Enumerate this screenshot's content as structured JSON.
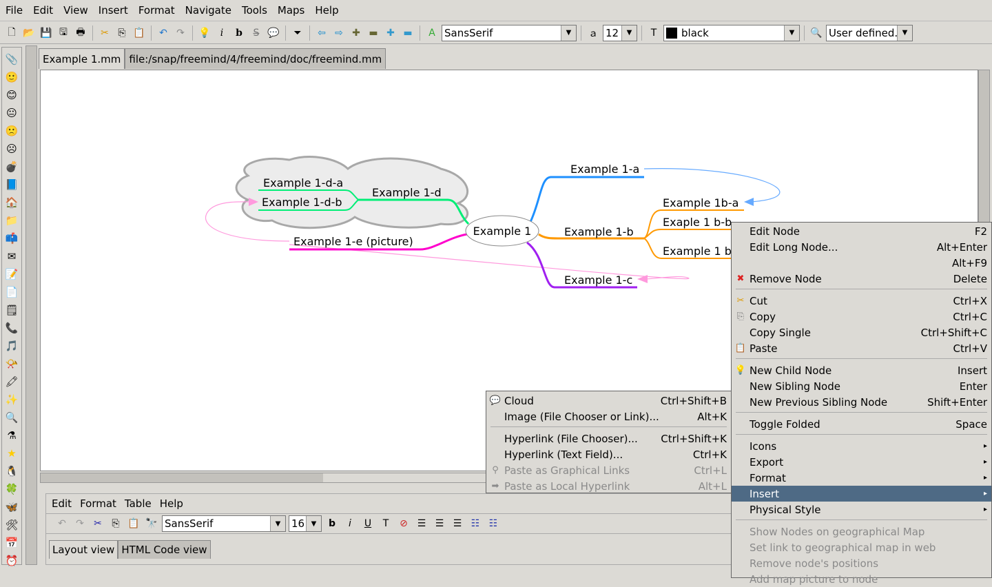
{
  "menubar": {
    "items": [
      "File",
      "Edit",
      "View",
      "Insert",
      "Format",
      "Navigate",
      "Tools",
      "Maps",
      "Help"
    ]
  },
  "toolbar": {
    "font": "SansSerif",
    "size": "12",
    "color_name": "black",
    "color": "#000000",
    "style": "User defined."
  },
  "tabs": [
    {
      "label": "Example 1.mm",
      "active": true
    },
    {
      "label": "file:/snap/freemind/4/freemind/doc/freemind.mm",
      "active": false
    }
  ],
  "mindmap": {
    "root": "Example 1",
    "nodes": {
      "a": "Example 1-a",
      "b": "Example 1-b",
      "ba": "Example 1b-a",
      "bb": "Exaple 1 b-b",
      "bc": "Example 1 b",
      "c": "Example 1-c",
      "d": "Example 1-d",
      "da": "Example 1-d-a",
      "db": "Example 1-d-b",
      "e": "Example 1-e (picture)"
    },
    "colors": {
      "a": "#1e90ff",
      "b": "#ff9900",
      "c": "#a020f0",
      "d": "#00ee76",
      "e": "#ff00cc",
      "link_blue": "#66aaff",
      "link_pink": "#ff99dd"
    }
  },
  "context_menu": {
    "items": [
      {
        "label": "Edit Node",
        "shortcut": "F2",
        "icon": ""
      },
      {
        "label": "Edit Long Node...",
        "shortcut": "Alt+Enter",
        "icon": ""
      },
      {
        "label": "",
        "shortcut": "Alt+F9",
        "icon": ""
      },
      {
        "label": "Remove Node",
        "shortcut": "Delete",
        "icon": "remove-icon"
      },
      {
        "label": "Cut",
        "shortcut": "Ctrl+X",
        "icon": "cut-icon"
      },
      {
        "label": "Copy",
        "shortcut": "Ctrl+C",
        "icon": "copy-icon"
      },
      {
        "label": "Copy Single",
        "shortcut": "Ctrl+Shift+C",
        "icon": ""
      },
      {
        "label": "Paste",
        "shortcut": "Ctrl+V",
        "icon": "paste-icon"
      },
      {
        "label": "New Child Node",
        "shortcut": "Insert",
        "icon": "bulb-icon"
      },
      {
        "label": "New Sibling Node",
        "shortcut": "Enter",
        "icon": ""
      },
      {
        "label": "New Previous Sibling Node",
        "shortcut": "Shift+Enter",
        "icon": ""
      },
      {
        "label": "Toggle Folded",
        "shortcut": "Space",
        "icon": ""
      },
      {
        "label": "Icons",
        "shortcut": "",
        "icon": ""
      },
      {
        "label": "Export",
        "shortcut": "",
        "icon": ""
      },
      {
        "label": "Format",
        "shortcut": "",
        "icon": ""
      },
      {
        "label": "Insert",
        "shortcut": "",
        "icon": ""
      },
      {
        "label": "Physical Style",
        "shortcut": "",
        "icon": ""
      },
      {
        "label": "Show Nodes on geographical Map",
        "shortcut": "",
        "icon": ""
      },
      {
        "label": "Set link to geographical map in web",
        "shortcut": "",
        "icon": ""
      },
      {
        "label": "Remove node's positions",
        "shortcut": "",
        "icon": ""
      },
      {
        "label": "Add map picture to node",
        "shortcut": "",
        "icon": ""
      }
    ]
  },
  "submenu": {
    "items": [
      {
        "label": "Cloud",
        "shortcut": "Ctrl+Shift+B"
      },
      {
        "label": "Image (File Chooser or Link)...",
        "shortcut": "Alt+K"
      },
      {
        "label": "Hyperlink (File Chooser)...",
        "shortcut": "Ctrl+Shift+K"
      },
      {
        "label": "Hyperlink (Text Field)...",
        "shortcut": "Ctrl+K"
      },
      {
        "label": "Paste as Graphical Links",
        "shortcut": "Ctrl+L"
      },
      {
        "label": "Paste as Local Hyperlink",
        "shortcut": "Alt+L"
      }
    ]
  },
  "editor": {
    "menu": [
      "Edit",
      "Format",
      "Table",
      "Help"
    ],
    "font": "SansSerif",
    "size": "16",
    "views": [
      "Layout view",
      "HTML Code view"
    ]
  }
}
